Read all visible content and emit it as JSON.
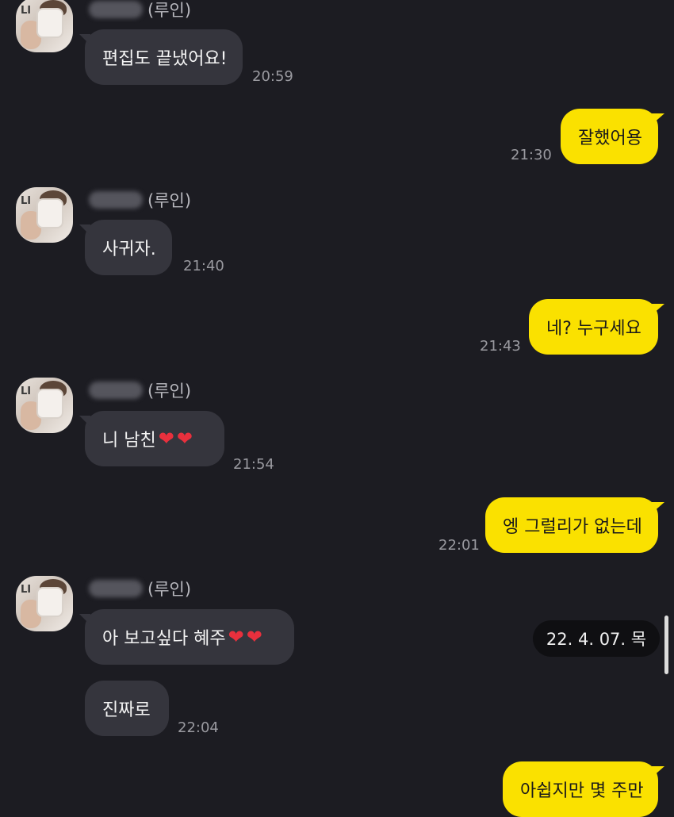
{
  "chat": {
    "sender_suffix": "(루인)",
    "messages": [
      {
        "text": "편집도 끝냈어요!",
        "time": "20:59"
      },
      {
        "text": "잘했어용",
        "time": "21:30"
      },
      {
        "text": "사귀자.",
        "time": "21:40"
      },
      {
        "text": "네? 누구세요",
        "time": "21:43"
      },
      {
        "text": "니 남친",
        "time": "21:54"
      },
      {
        "text": "엥 그럴리가 없는데",
        "time": "22:01"
      },
      {
        "text": "아 보고싶다 혜주",
        "time": ""
      },
      {
        "text": "진짜로",
        "time": "22:04"
      },
      {
        "text": "아쉽지만 몇 주만",
        "time": ""
      }
    ],
    "heart_glyph": "❤",
    "date_badge": "22. 4. 07. 목"
  },
  "colors": {
    "background": "#1c1c22",
    "incoming_bubble": "#35353d",
    "outgoing_bubble": "#fae100",
    "heart": "#e8303d"
  },
  "icons": [
    "profile-avatar",
    "heart-emoji"
  ]
}
